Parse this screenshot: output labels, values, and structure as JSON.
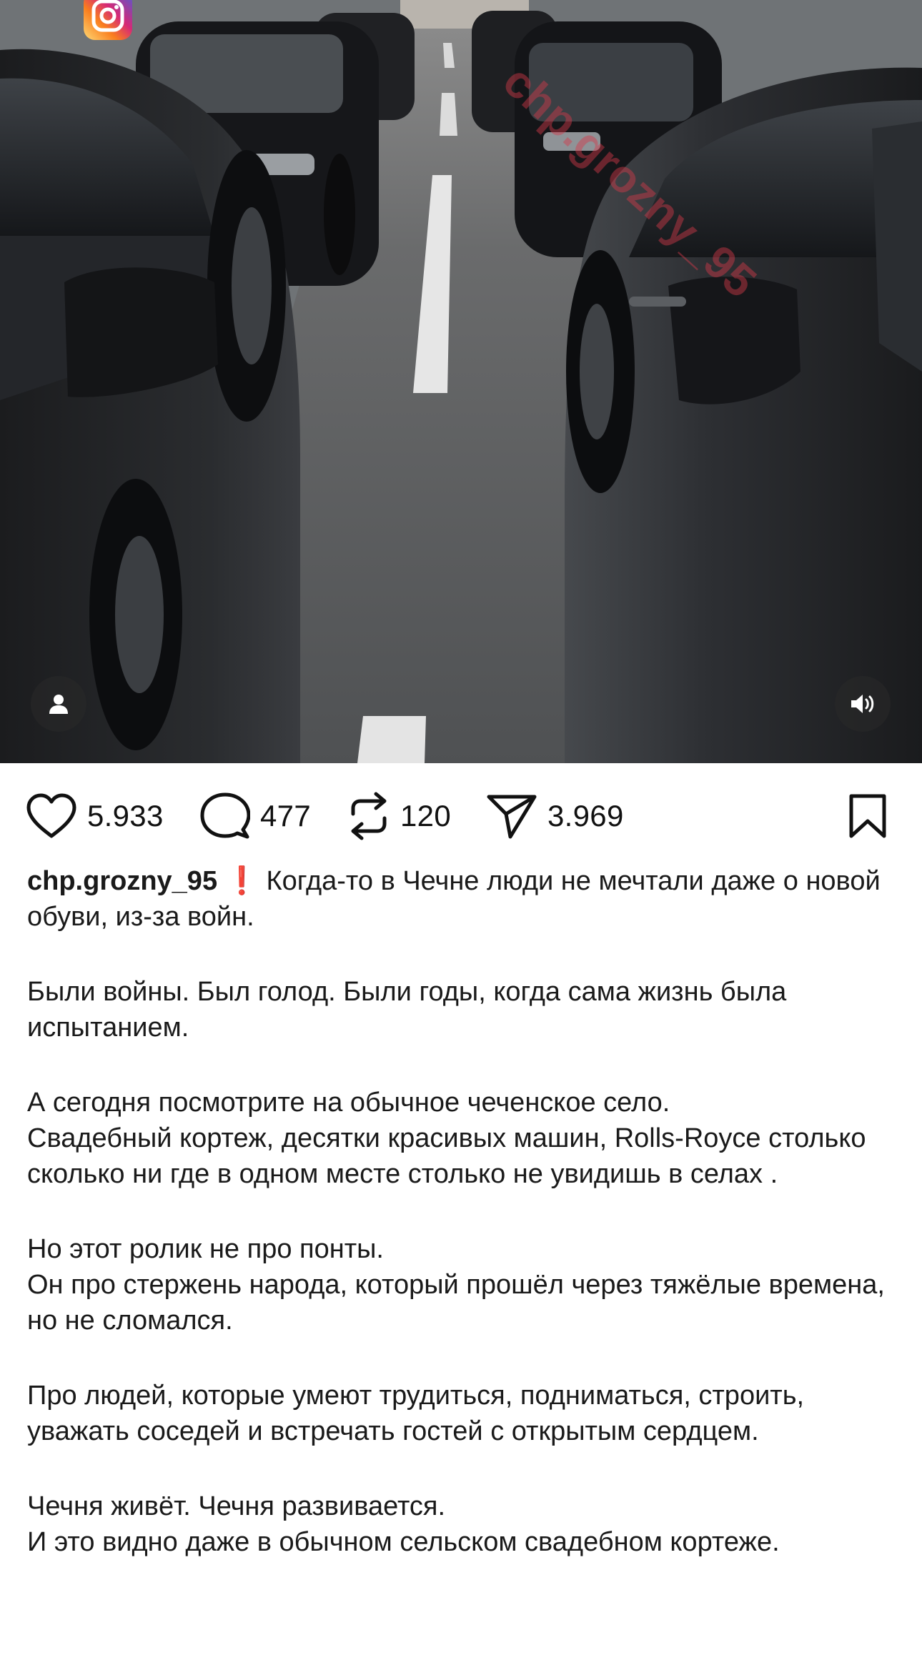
{
  "post": {
    "icons": {
      "user_tag": "user-icon",
      "sound": "speaker-icon",
      "instagram": "instagram-icon",
      "like": "heart-icon",
      "comment": "comment-bubble-icon",
      "repost": "repost-icon",
      "share": "send-icon",
      "save": "bookmark-icon"
    },
    "watermark": "chp.grozny_95",
    "actions": {
      "likes": "5.933",
      "comments": "477",
      "reposts": "120",
      "shares": "3.969"
    },
    "caption": {
      "username": "chp.grozny_95",
      "emoji": "❗",
      "lead": " Когда-то в Чечне люди не мечтали даже о новой обуви, из-за войн.",
      "para1": "Были войны. Был голод. Были годы, когда сама жизнь была испытанием.",
      "para2_line1": "А сегодня посмотрите на обычное чеченское село.",
      "para2_line2": "Свадебный кортеж, десятки красивых машин, Rolls-Royce столько сколько ни где в одном месте столько не увидишь в селах .",
      "para3_line1": "Но этот ролик не про понты.",
      "para3_line2": "Он про стержень народа, который прошёл через тяжёлые времена, но не сломался.",
      "para4": "Про людей, которые умеют трудиться, подниматься, строить, уважать соседей и встречать гостей с открытым сердцем.",
      "para5_line1": "Чечня живёт. Чечня развивается.",
      "para5_line2": "И это видно даже в обычном сельском свадебном кортеже."
    },
    "colors": {
      "accent_red": "#d9262e",
      "text": "#111111",
      "background": "#ffffff"
    }
  }
}
